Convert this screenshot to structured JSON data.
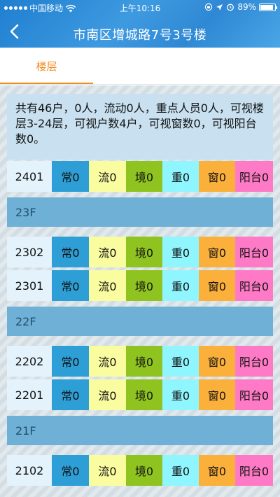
{
  "status": {
    "carrier": "中国移动",
    "time": "上午10:16",
    "battery": "89%",
    "battery_level": 0.89
  },
  "nav": {
    "title": "市南区增城路7号3号楼"
  },
  "tabs": [
    {
      "label": "楼层",
      "active": true
    }
  ],
  "summary": "共有46户，0人，流动0人，重点人员0人，可视楼层3-24层，可视户数4户，可视窗数0，可视阳台数0。",
  "colors": {
    "chang": "#2d9fd6",
    "liu": "#fafca0",
    "jing": "#8fc31f",
    "zhong": "#8ff6ff",
    "chuang": "#fbb03b",
    "yangtai": "#ff7ac6",
    "floor_bg": "#6fb1d6",
    "accent": "#f28c1e"
  },
  "list": [
    {
      "type": "unit",
      "room": "2401",
      "tags": [
        "常0",
        "流0",
        "境0",
        "重0",
        "窗0",
        "阳台0"
      ]
    },
    {
      "type": "floor",
      "label": "23F"
    },
    {
      "type": "unit",
      "room": "2302",
      "tags": [
        "常0",
        "流0",
        "境0",
        "重0",
        "窗0",
        "阳台0"
      ]
    },
    {
      "type": "unit",
      "room": "2301",
      "tags": [
        "常0",
        "流0",
        "境0",
        "重0",
        "窗0",
        "阳台0"
      ]
    },
    {
      "type": "floor",
      "label": "22F"
    },
    {
      "type": "unit",
      "room": "2202",
      "tags": [
        "常0",
        "流0",
        "境0",
        "重0",
        "窗0",
        "阳台0"
      ]
    },
    {
      "type": "unit",
      "room": "2201",
      "tags": [
        "常0",
        "流0",
        "境0",
        "重0",
        "窗0",
        "阳台0"
      ]
    },
    {
      "type": "floor",
      "label": "21F"
    },
    {
      "type": "unit",
      "room": "2102",
      "tags": [
        "常0",
        "流0",
        "境0",
        "重0",
        "窗0",
        "阳台0"
      ]
    }
  ]
}
